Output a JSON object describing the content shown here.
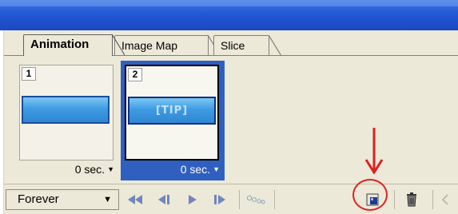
{
  "tabs": [
    {
      "label": "Animation",
      "active": true
    },
    {
      "label": "Image Map",
      "active": false
    },
    {
      "label": "Slice",
      "active": false
    }
  ],
  "frames": [
    {
      "number": "1",
      "delay": "0 sec.",
      "selected": false
    },
    {
      "number": "2",
      "delay": "0 sec.",
      "selected": true,
      "banner_text": "[TIP]"
    }
  ],
  "toolbar": {
    "loop_value": "Forever",
    "buttons": [
      {
        "name": "first-frame-icon"
      },
      {
        "name": "previous-frame-icon"
      },
      {
        "name": "play-icon"
      },
      {
        "name": "next-frame-icon"
      },
      {
        "name": "tween-icon"
      },
      {
        "name": "duplicate-frame-icon"
      },
      {
        "name": "delete-frame-icon"
      }
    ]
  },
  "colors": {
    "selection": "#2f5fbf",
    "annotation": "#e02020",
    "panel_bg": "#ece9d8"
  }
}
